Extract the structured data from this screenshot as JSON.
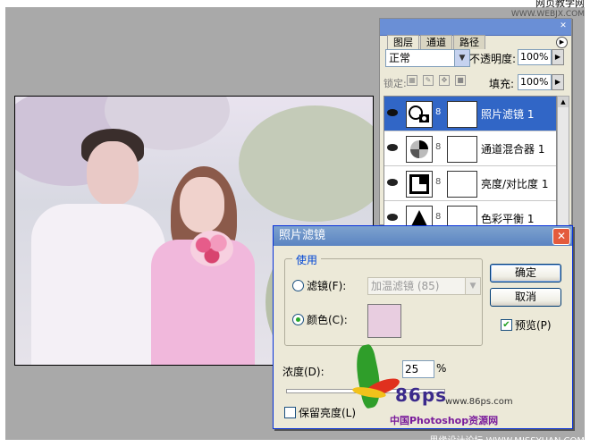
{
  "watermark": {
    "top_cn": "网页教学网",
    "top_url": "WWW.WEBJX.COM",
    "bottom": "思缘设计论坛  WWW.MISSYUAN.COM"
  },
  "layers_panel": {
    "tabs": [
      {
        "label": "图层",
        "active": true
      },
      {
        "label": "通道",
        "active": false
      },
      {
        "label": "路径",
        "active": false
      }
    ],
    "blend_mode": "正常",
    "opacity_label": "不透明度:",
    "opacity_value": "100%",
    "lock_label": "锁定:",
    "fill_label": "填充:",
    "fill_value": "100%",
    "layers": [
      {
        "name": "照片滤镜 1",
        "selected": true
      },
      {
        "name": "通道混合器 1",
        "selected": false
      },
      {
        "name": "亮度/对比度 1",
        "selected": false
      },
      {
        "name": "色彩平衡 1",
        "selected": false
      }
    ]
  },
  "dialog": {
    "title": "照片滤镜",
    "group_label": "使用",
    "filter_option_label": "滤镜(F):",
    "filter_option_selected": false,
    "filter_value": "加温滤镜 (85)",
    "color_option_label": "颜色(C):",
    "color_option_selected": true,
    "color_value": "#e8cde0",
    "ok_label": "确定",
    "cancel_label": "取消",
    "preview_label": "预览(P)",
    "preview_checked": true,
    "density_label": "浓度(D):",
    "density_value": "25",
    "density_unit": "%",
    "preserve_label": "保留亮度(L)",
    "preserve_checked": false
  },
  "logo": {
    "brand": "86ps",
    "url": "www.86ps.com",
    "tagline": "中国Photoshop资源网"
  }
}
